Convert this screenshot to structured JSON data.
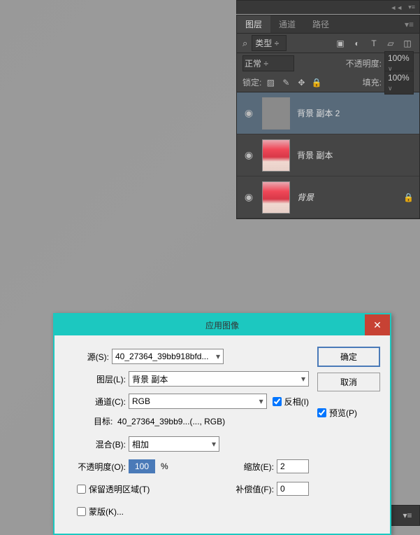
{
  "panel": {
    "tabs": {
      "layers": "图层",
      "channels": "通道",
      "paths": "路径"
    },
    "type_filter": "类型",
    "blend_mode": "正常",
    "opacity_label": "不透明度:",
    "opacity_value": "100%",
    "lock_label": "锁定:",
    "fill_label": "填充:",
    "fill_value": "100%",
    "layers": [
      {
        "name": "背景 副本 2",
        "selected": true,
        "pink": false,
        "italic": false,
        "locked": false
      },
      {
        "name": "背景 副本",
        "selected": false,
        "pink": true,
        "italic": false,
        "locked": false
      },
      {
        "name": "背景",
        "selected": false,
        "pink": true,
        "italic": true,
        "locked": true
      }
    ]
  },
  "dialog": {
    "title": "应用图像",
    "source_label": "源(S):",
    "source_value": "40_27364_39bb918bfd...",
    "layer_label": "图层(L):",
    "layer_value": "背景 副本",
    "channel_label": "通道(C):",
    "channel_value": "RGB",
    "invert_label": "反相(I)",
    "target_label": "目标:",
    "target_value": "40_27364_39bb9...(..., RGB)",
    "blend_label": "混合(B):",
    "blend_value": "相加",
    "opacity_label": "不透明度(O):",
    "opacity_value": "100",
    "pct": "%",
    "scale_label": "缩放(E):",
    "scale_value": "2",
    "preserve_label": "保留透明区域(T)",
    "offset_label": "补偿值(F):",
    "offset_value": "0",
    "mask_label": "蒙版(K)...",
    "ok": "确定",
    "cancel": "取消",
    "preview": "预览(P)"
  }
}
